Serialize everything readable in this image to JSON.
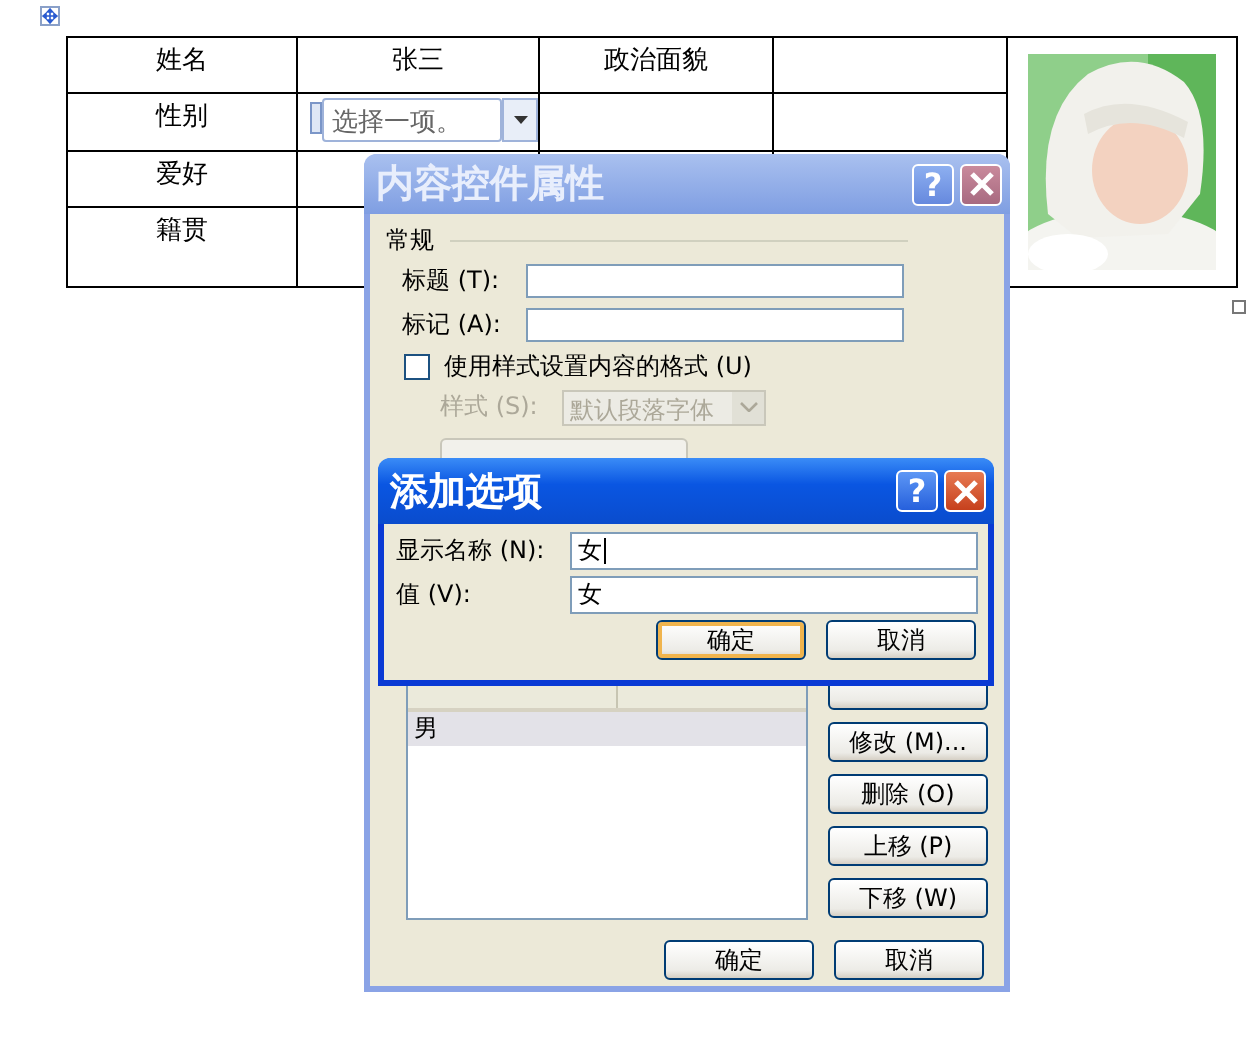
{
  "table": {
    "rows": [
      {
        "label": "姓名",
        "cells": [
          "张三",
          "政治面貌"
        ]
      },
      {
        "label": "性别",
        "dropdown": {
          "placeholder": "选择一项。"
        }
      },
      {
        "label": "爱好"
      },
      {
        "label": "籍贯"
      }
    ]
  },
  "properties_dialog": {
    "title": "内容控件属性",
    "active": false,
    "help": "?",
    "section": "常规",
    "fields": [
      {
        "label": "标题 (T):"
      },
      {
        "label": "标记 (A):"
      }
    ],
    "style_checkbox": {
      "label": "使用样式设置内容的格式 (U)",
      "checked": false
    },
    "style_select": {
      "label": "样式 (S):",
      "value": "默认段落字体",
      "disabled": true
    },
    "list": {
      "rows": [
        {
          "name": "男",
          "selected": true
        }
      ]
    },
    "side_buttons": [
      "修改 (M)...",
      "删除 (O)",
      "上移 (P)",
      "下移 (W)"
    ],
    "buttons": [
      "确定",
      "取消"
    ]
  },
  "add_dialog": {
    "title": "添加选项",
    "active": true,
    "help": "?",
    "fields": [
      {
        "label": "显示名称 (N):",
        "value": "女",
        "focused": true
      },
      {
        "label": "值 (V):",
        "value": "女",
        "focused": false
      }
    ],
    "buttons": [
      {
        "label": "确定",
        "default": true
      },
      {
        "label": "取消",
        "default": false
      }
    ]
  }
}
